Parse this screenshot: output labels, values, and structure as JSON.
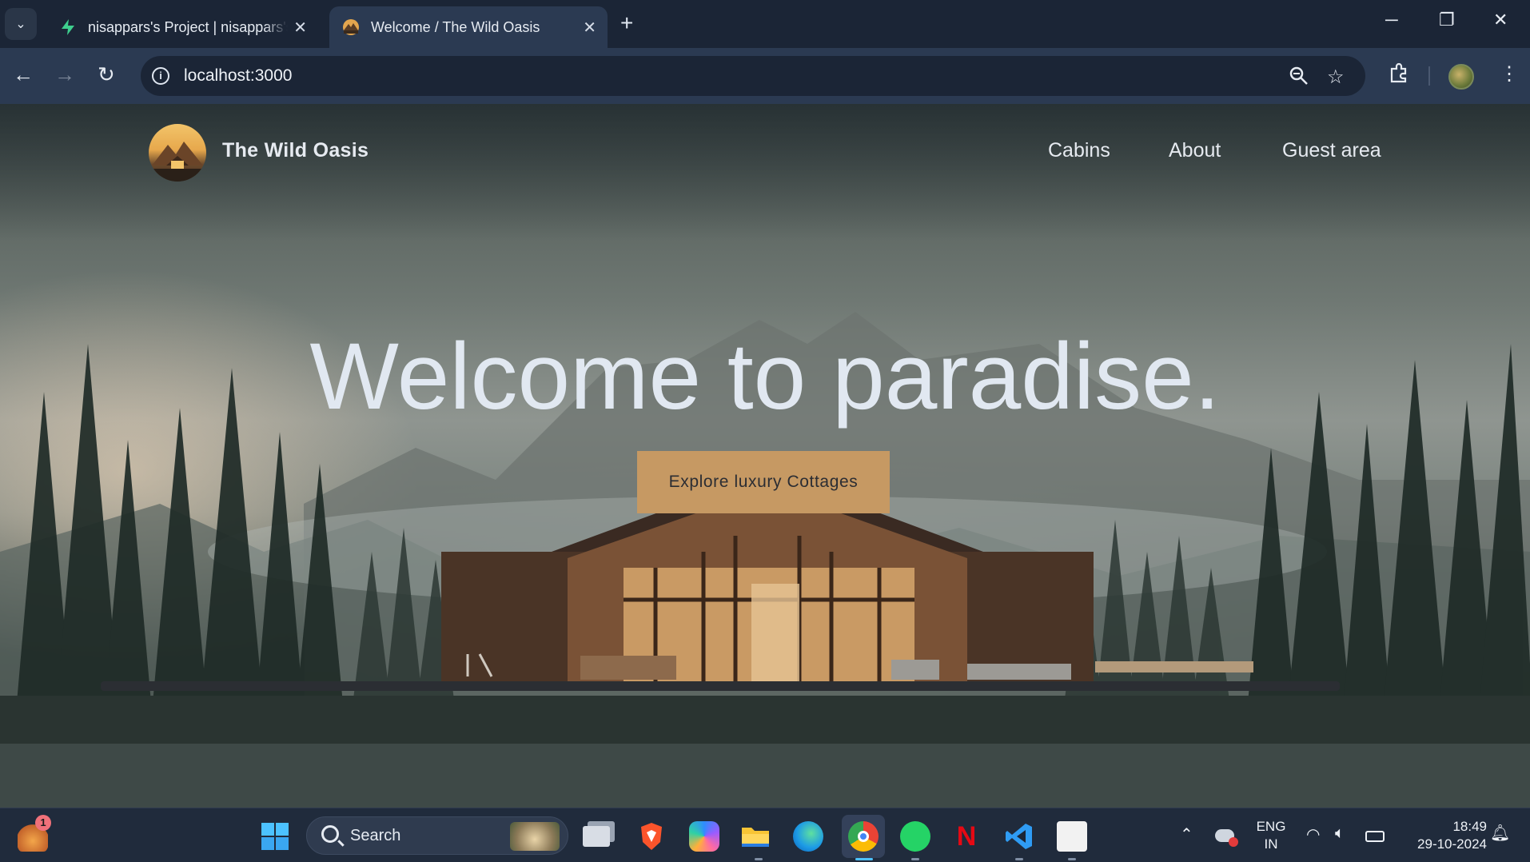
{
  "browser": {
    "tabs": [
      {
        "title": "nisappars's Project | nisappars's",
        "active": false
      },
      {
        "title": "Welcome / The Wild Oasis",
        "active": true
      }
    ],
    "new_tab_label": "+",
    "url": "localhost:3000"
  },
  "site": {
    "brand": "The Wild Oasis",
    "nav": [
      {
        "label": "Cabins"
      },
      {
        "label": "About"
      },
      {
        "label": "Guest area"
      }
    ],
    "hero_title": "Welcome to paradise.",
    "cta_label": "Explore luxury Cottages",
    "accent_color": "#c69963"
  },
  "taskbar": {
    "search_label": "Search",
    "notification_count": "1",
    "language": {
      "line1": "ENG",
      "line2": "IN"
    },
    "time": "18:49",
    "date": "29-10-2024"
  }
}
